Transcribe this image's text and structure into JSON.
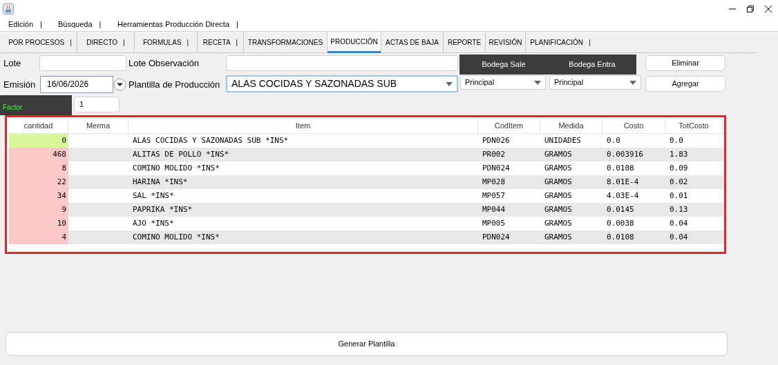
{
  "menu": [
    {
      "label": "Edición",
      "separator": "|"
    },
    {
      "label": "Búsqueda",
      "separator": "|"
    },
    {
      "label": "Herramientas Producción Directa",
      "separator": "|"
    }
  ],
  "tabs": [
    {
      "label": "POR PROCESOS",
      "separator": "|",
      "selected": false
    },
    {
      "label": "DIRECTO",
      "separator": "|",
      "selected": false
    },
    {
      "label": "FORMULAS",
      "separator": "|",
      "selected": false
    },
    {
      "label": "RECETA",
      "separator": "|",
      "selected": false
    },
    {
      "label": "TRANSFORMACIONES",
      "selected": false
    },
    {
      "label": "PRODUCCIÓN",
      "selected": true
    },
    {
      "label": "ACTAS DE BAJA",
      "selected": false
    },
    {
      "label": "REPORTE",
      "selected": false
    },
    {
      "label": "REVISIÓN",
      "selected": false
    },
    {
      "label": "PLANIFICACIÓN",
      "separator": "|",
      "selected": false
    }
  ],
  "form": {
    "lote_label": "Lote",
    "lote_obs_label": "Lote Observación",
    "emision_label": "Emisión",
    "emision_value": "16/06/2026",
    "plantilla_label": "Plantilla de Producción",
    "plantilla_value": "ALAS COCIDAS Y SAZONADAS SUB",
    "bodega_sale_label": "Bodega Sale",
    "bodega_entra_label": "Bodega Entra",
    "bodega_sale_value": "Principal",
    "bodega_entra_value": "Principal",
    "factor_label": "Factor",
    "factor_value": "1"
  },
  "buttons": {
    "eliminar": "Eliminar",
    "agregar": "Agregar",
    "generar": "Generar Plantilla"
  },
  "table": {
    "columns": [
      "cantidad",
      "Merma",
      "Item",
      "CodItem",
      "Medida",
      "Costo",
      "TotCosto"
    ],
    "rows": [
      {
        "cantidad": "0",
        "color": "#d9f79a",
        "item": "ALAS COCIDAS Y SAZONADAS SUB *INS*",
        "coditem": "PDN026",
        "medida": "UNIDADES",
        "costo": "0.0",
        "totcosto": "0.0"
      },
      {
        "cantidad": "468",
        "color": "#ffc8c8",
        "item": "ALITAS DE POLLO *INS*",
        "coditem": "PR002",
        "medida": "GRAMOS",
        "costo": "0.003916",
        "totcosto": "1.83"
      },
      {
        "cantidad": "8",
        "color": "#ffc8c8",
        "item": "COMINO MOLIDO *INS*",
        "coditem": "PDN024",
        "medida": "GRAMOS",
        "costo": "0.0108",
        "totcosto": "0.09"
      },
      {
        "cantidad": "22",
        "color": "#ffc8c8",
        "item": "HARINA *INS*",
        "coditem": "MP028",
        "medida": "GRAMOS",
        "costo": "8.01E-4",
        "totcosto": "0.02"
      },
      {
        "cantidad": "34",
        "color": "#ffc8c8",
        "item": "SAL *INS*",
        "coditem": "MP057",
        "medida": "GRAMOS",
        "costo": "4.03E-4",
        "totcosto": "0.01"
      },
      {
        "cantidad": "9",
        "color": "#ffc8c8",
        "item": "PAPRIKA *INS*",
        "coditem": "MP044",
        "medida": "GRAMOS",
        "costo": "0.0145",
        "totcosto": "0.13"
      },
      {
        "cantidad": "10",
        "color": "#ffc8c8",
        "item": "AJO *INS*",
        "coditem": "MP005",
        "medida": "GRAMOS",
        "costo": "0.0038",
        "totcosto": "0.04"
      },
      {
        "cantidad": "4",
        "color": "#ffc8c8",
        "item": "COMINO MOLIDO *INS*",
        "coditem": "PDN024",
        "medida": "GRAMOS",
        "costo": "0.0108",
        "totcosto": "0.04"
      }
    ]
  }
}
